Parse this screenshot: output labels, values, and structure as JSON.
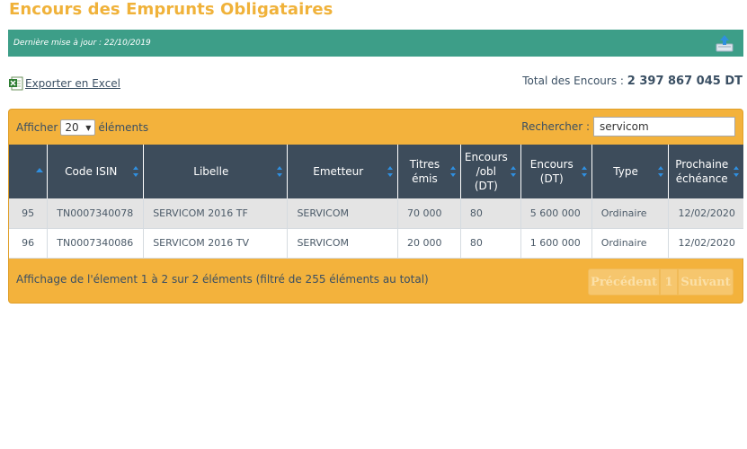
{
  "page": {
    "title": "Encours des Emprunts Obligataires"
  },
  "update_bar": {
    "text": "Dernière mise à jour : 22/10/2019",
    "icon": "upload-icon"
  },
  "export": {
    "label": "Exporter en Excel",
    "icon": "excel-icon"
  },
  "total": {
    "label": "Total des Encours :",
    "value": "2 397 867 045 DT"
  },
  "controls": {
    "show_prefix": "Afficher",
    "page_size": "20",
    "show_suffix": "éléments",
    "search_label": "Rechercher :",
    "search_value": "servicom"
  },
  "table": {
    "columns": [
      "",
      "Code ISIN",
      "Libelle",
      "Emetteur",
      "Titres émis",
      "Encours /obl (DT)",
      "Encours (DT)",
      "Type",
      "Prochaine échéance"
    ],
    "rows": [
      {
        "id": "95",
        "isin": "TN0007340078",
        "libelle": "SERVICOM 2016 TF",
        "emetteur": "SERVICOM",
        "titres": "70 000",
        "encours_obl": "80",
        "encours": "5 600 000",
        "type": "Ordinaire",
        "echeance": "12/02/2020"
      },
      {
        "id": "96",
        "isin": "TN0007340086",
        "libelle": "SERVICOM 2016 TV",
        "emetteur": "SERVICOM",
        "titres": "20 000",
        "encours_obl": "80",
        "encours": "1 600 000",
        "type": "Ordinaire",
        "echeance": "12/02/2020"
      }
    ]
  },
  "footer": {
    "info": "Affichage de l'élement 1 à 2 sur 2 éléments (filtré de 255 éléments au total)",
    "prev": "Précédent",
    "page": "1",
    "next": "Suivant"
  },
  "colors": {
    "title": "#f0b23a",
    "update_bar": "#3d9e88",
    "panel": "#f3b23c",
    "table_header": "#3d4c5b",
    "sort_icon": "#2f8fe0"
  }
}
